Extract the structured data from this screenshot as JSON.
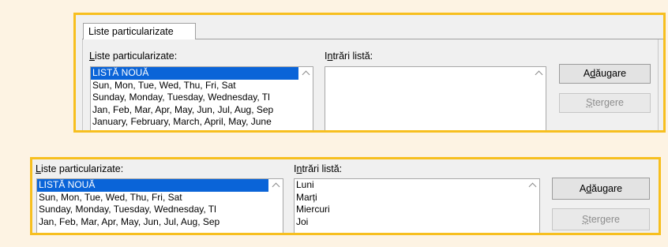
{
  "top_dialog": {
    "tab_label": "Liste particularizate",
    "custom_lists_label": "Liste particularizate:",
    "list_entries_label": "Intrări listă:",
    "custom_lists": [
      "LISTĂ NOUĂ",
      "Sun, Mon, Tue, Wed, Thu, Fri, Sat",
      "Sunday, Monday, Tuesday, Wednesday, Tl",
      "Jan, Feb, Mar, Apr, May, Jun, Jul, Aug, Sep",
      "January, February, March, April, May, June"
    ],
    "selected_index": 0,
    "entries": [],
    "add_button": "Adăugare",
    "delete_button": "Ștergere"
  },
  "bottom_dialog": {
    "custom_lists_label": "Liste particularizate:",
    "list_entries_label": "Intrări listă:",
    "custom_lists": [
      "LISTĂ NOUĂ",
      "Sun, Mon, Tue, Wed, Thu, Fri, Sat",
      "Sunday, Monday, Tuesday, Wednesday, Tl",
      "Jan, Feb, Mar, Apr, May, Jun, Jul, Aug, Sep"
    ],
    "selected_index": 0,
    "entries": [
      "Luni",
      "Marți",
      "Miercuri",
      "Joi"
    ],
    "add_button": "Adăugare",
    "delete_button": "Ștergere"
  },
  "colors": {
    "highlight_border": "#f7bf1f",
    "selection": "#0a64d8",
    "page_background": "#fdf3e3"
  }
}
